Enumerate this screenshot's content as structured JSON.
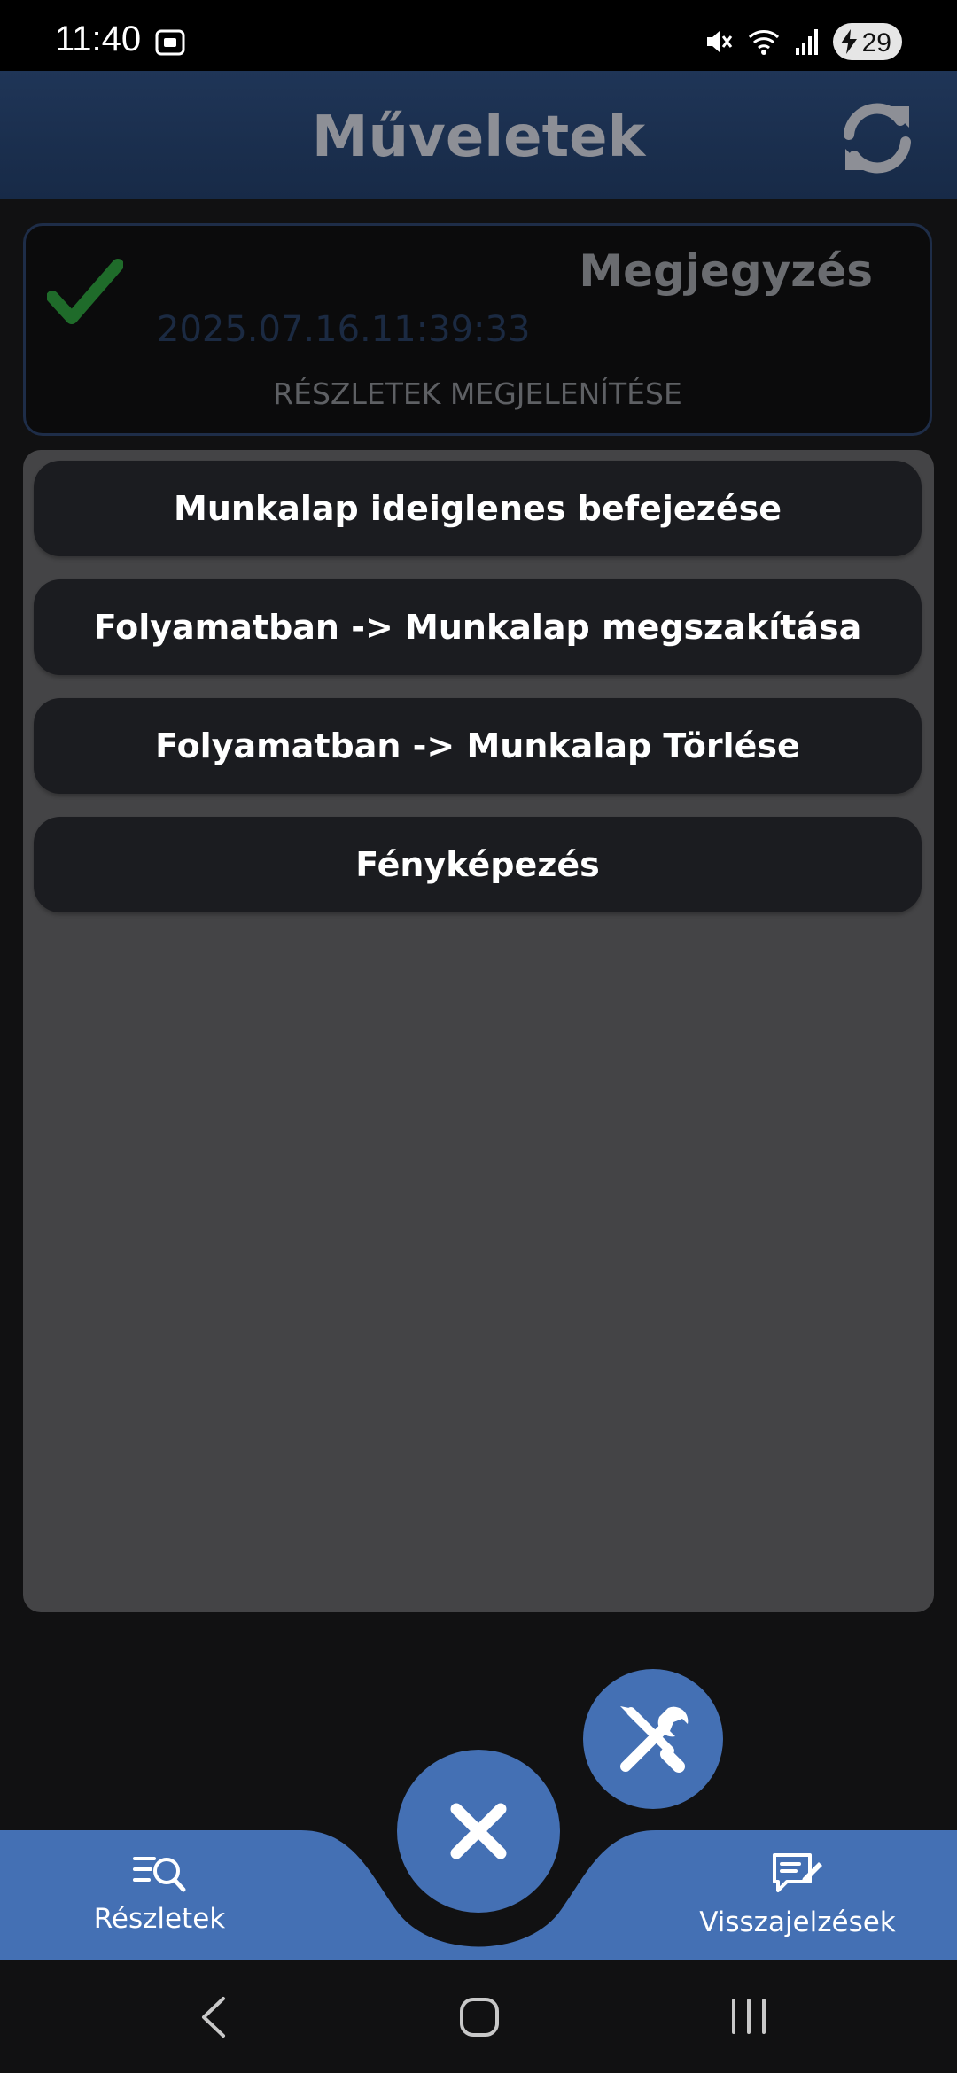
{
  "status_bar": {
    "time": "11:40",
    "battery": "29"
  },
  "header": {
    "title": "Műveletek"
  },
  "note_card": {
    "label": "Megjegyzés",
    "date": "2025.07.16.11:39:33",
    "details_link": "RÉSZLETEK MEGJELENÍTÉSE"
  },
  "actions": [
    {
      "label": "Munkalap ideiglenes befejezése"
    },
    {
      "label": "Folyamatban -> Munkalap megszakítása"
    },
    {
      "label": "Folyamatban -> Munkalap Törlése"
    },
    {
      "label": "Fényképezés"
    }
  ],
  "bottom_nav": {
    "left_label": "Részletek",
    "right_label": "Visszajelzések"
  },
  "colors": {
    "accent": "#4470b4",
    "appbar": "#1f3557",
    "check": "#1f6b2a",
    "panel": "#444446"
  }
}
